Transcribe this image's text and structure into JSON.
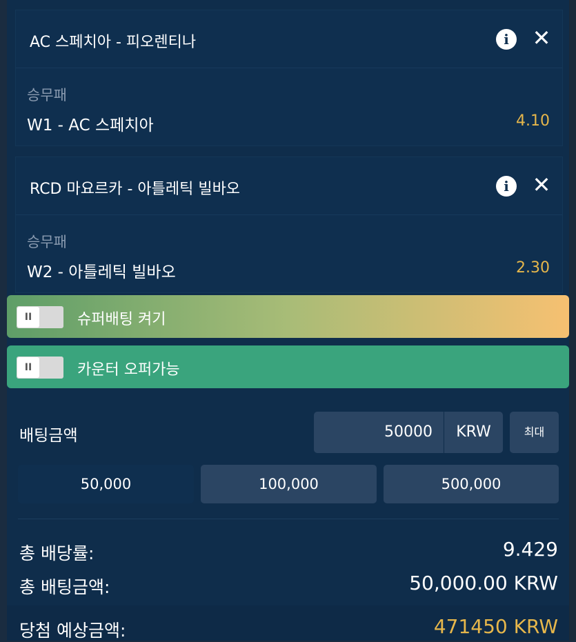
{
  "bets": [
    {
      "match": "AC 스페치아 - 피오렌티나",
      "market": "승무패",
      "selection": "W1 - AC 스페치아",
      "odds": "4.10"
    },
    {
      "match": "RCD 마요르카 - 아틀레틱 빌바오",
      "market": "승무패",
      "selection": "W2 - 아틀레틱 빌바오",
      "odds": "2.30"
    }
  ],
  "icons": {
    "info": "info-icon",
    "close": "close-icon",
    "toggle": "pause-icon"
  },
  "toggles": [
    {
      "label": "슈퍼배팅 켜기",
      "knob": "II"
    },
    {
      "label": "카운터 오퍼가능",
      "knob": "II"
    }
  ],
  "stake": {
    "label": "배팅금액",
    "value": "50000",
    "currency": "KRW",
    "max_label": "최대",
    "quick_amounts": [
      "50,000",
      "100,000",
      "500,000"
    ]
  },
  "summary": {
    "total_odds_label": "총 배당률:",
    "total_odds_value": "9.429",
    "total_stake_label": "총 배팅금액:",
    "total_stake_value": "50,000.00 KRW",
    "potential_win_label": "당첨 예상금액:",
    "potential_win_value": "471450 KRW"
  },
  "colors": {
    "background": "#0f2d4b",
    "odds": "#e7b74b",
    "super_bet_gradient_start": "#5e9e68",
    "super_bet_gradient_end": "#f6c071",
    "counter_offer": "#3aa47d",
    "button": "#2b4563"
  }
}
